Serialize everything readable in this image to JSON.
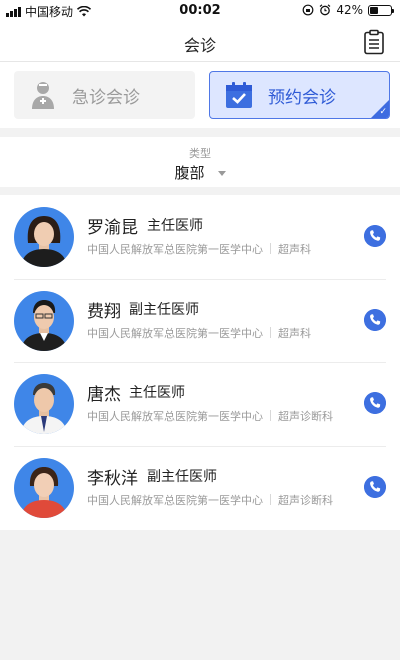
{
  "status_bar": {
    "carrier": "中国移动",
    "time": "00:02",
    "battery": "42%",
    "battery_level": 0.42
  },
  "nav": {
    "title": "会诊",
    "action_icon": "clipboard-icon"
  },
  "mode_tabs": [
    {
      "label": "急诊会诊",
      "icon": "doctor-icon",
      "selected": false
    },
    {
      "label": "预约会诊",
      "icon": "calendar-check-icon",
      "selected": true
    }
  ],
  "filter": {
    "label": "类型",
    "value": "腹部"
  },
  "doctors": [
    {
      "name": "罗渝昆",
      "title": "主任医师",
      "hospital": "中国人民解放军总医院第一医学中心",
      "department": "超声科"
    },
    {
      "name": "费翔",
      "title": "副主任医师",
      "hospital": "中国人民解放军总医院第一医学中心",
      "department": "超声科"
    },
    {
      "name": "唐杰",
      "title": "主任医师",
      "hospital": "中国人民解放军总医院第一医学中心",
      "department": "超声诊断科"
    },
    {
      "name": "李秋洋",
      "title": "副主任医师",
      "hospital": "中国人民解放军总医院第一医学中心",
      "department": "超声诊断科"
    }
  ],
  "colors": {
    "accent": "#3d6fe0",
    "selected_tab_bg": "#dde6ff",
    "avatar_bg": "#3f86e8"
  }
}
